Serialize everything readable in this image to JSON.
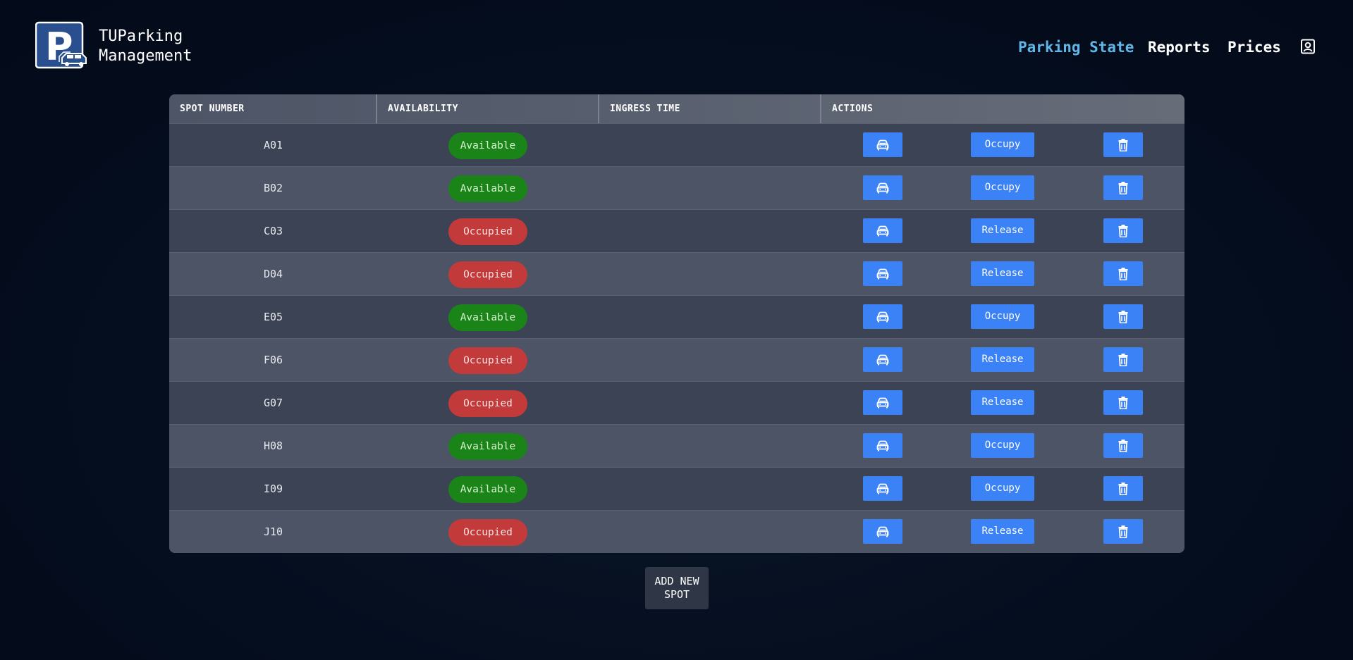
{
  "brand": {
    "line1": "TUParking",
    "line2": "Management",
    "logo_letter": "P"
  },
  "nav": {
    "items": [
      {
        "label": "Parking State",
        "active": true
      },
      {
        "label": "Reports",
        "active": false
      },
      {
        "label": "Prices",
        "active": false
      }
    ],
    "profile_icon": "user-profile-icon"
  },
  "table": {
    "headers": [
      "SPOT NUMBER",
      "AVAILABILITY",
      "INGRESS TIME",
      "ACTIONS"
    ],
    "rows": [
      {
        "spot": "A01",
        "status": "Available",
        "ingress": "",
        "action": "Occupy"
      },
      {
        "spot": "B02",
        "status": "Available",
        "ingress": "",
        "action": "Occupy"
      },
      {
        "spot": "C03",
        "status": "Occupied",
        "ingress": "",
        "action": "Release"
      },
      {
        "spot": "D04",
        "status": "Occupied",
        "ingress": "",
        "action": "Release"
      },
      {
        "spot": "E05",
        "status": "Available",
        "ingress": "",
        "action": "Occupy"
      },
      {
        "spot": "F06",
        "status": "Occupied",
        "ingress": "",
        "action": "Release"
      },
      {
        "spot": "G07",
        "status": "Occupied",
        "ingress": "",
        "action": "Release"
      },
      {
        "spot": "H08",
        "status": "Available",
        "ingress": "",
        "action": "Occupy"
      },
      {
        "spot": "I09",
        "status": "Available",
        "ingress": "",
        "action": "Occupy"
      },
      {
        "spot": "J10",
        "status": "Occupied",
        "ingress": "",
        "action": "Release"
      }
    ],
    "row_icons": {
      "vehicle": "car-icon",
      "delete": "trash-icon"
    }
  },
  "add_button": {
    "line1": "ADD NEW",
    "line2": "SPOT"
  },
  "colors": {
    "background": "#040d1e",
    "accent": "#3b82f6",
    "nav_active": "#5fb7e8",
    "available": "#1a8418",
    "occupied": "#c23a3a"
  }
}
